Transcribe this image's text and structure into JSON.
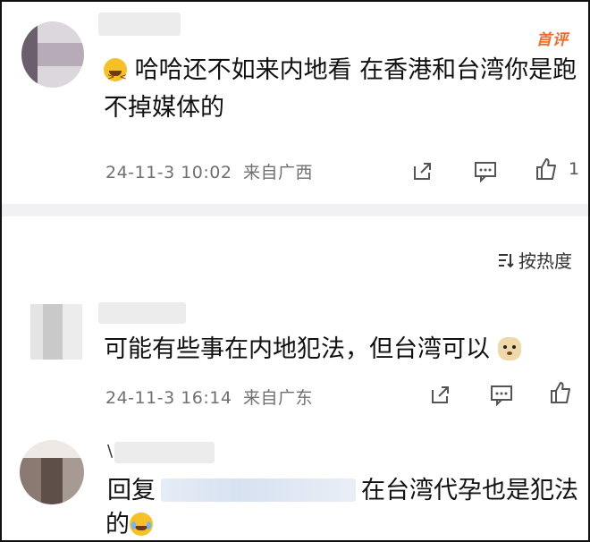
{
  "comments": [
    {
      "line1": "哈哈还不如来内地看 在香港和台湾你是跑",
      "line2": "不掉媒体的",
      "time": "24-11-3 10:02",
      "location": "来自广西",
      "like_count": "1",
      "badge": "首评"
    },
    {
      "line1": "可能有些事在内地犯法，但台湾可以",
      "time": "24-11-3 16:14",
      "location": "来自广东"
    },
    {
      "reply_mark": "\\",
      "reply_prefix": "回复",
      "line1_suffix": "在台湾代孕也是犯法",
      "line2": "的"
    }
  ],
  "sort": {
    "label": "按热度"
  },
  "icons": {
    "share": "share-icon",
    "comment": "comment-icon",
    "like": "thumbs-up-icon",
    "sort": "sort-icon"
  },
  "colors": {
    "badge": "#f36a2a",
    "meta": "#707070"
  }
}
